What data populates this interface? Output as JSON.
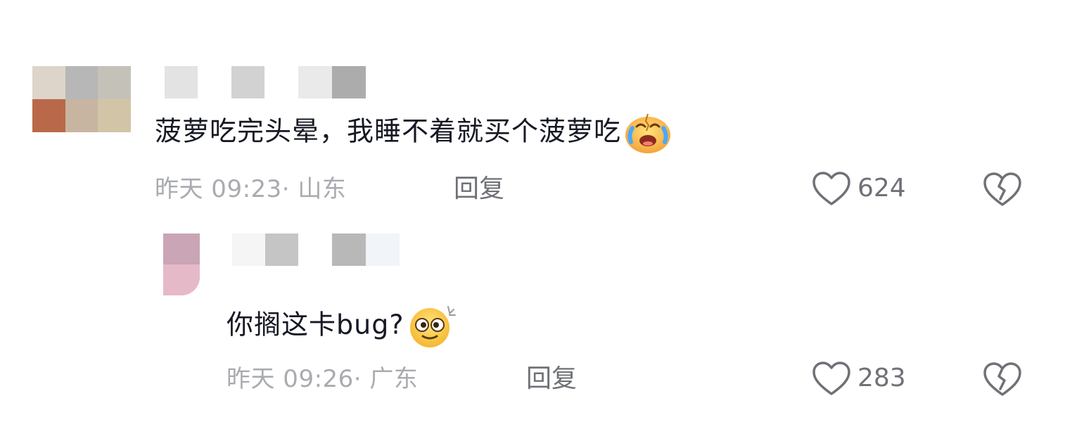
{
  "comments": [
    {
      "text": "菠萝吃完头晕，我睡不着就买个菠萝吃",
      "emoji": "crying-face-emoji",
      "meta": "昨天 09:23· 山东",
      "reply_label": "回复",
      "like_count": "624",
      "avatar_colors": [
        "#ddd4ca",
        "#b7b7b7",
        "#c4c1b8",
        "#b9694a",
        "#c7b5a1",
        "#d2c4a7"
      ],
      "name_colors_a": [
        "#e3e3e3",
        "#ffffff",
        "#d2d2d2",
        "#e3e3e3",
        "#ffffff",
        "#d2d2d2"
      ],
      "name_colors_b": [
        "#eaeaea",
        "#acacac"
      ]
    }
  ],
  "replies": [
    {
      "text": "你搁这卡bug?",
      "emoji": "dizzy-eyes-emoji",
      "meta": "昨天 09:26· 广东",
      "reply_label": "回复",
      "like_count": "283",
      "avatar_colors": [
        "#c9a5b5",
        "#e5b9c8"
      ],
      "name_colors_a": [
        "#f5f5f5",
        "#c5c5c5"
      ],
      "name_colors_b": [
        "#b8b8b8",
        "#f1f4f8"
      ]
    }
  ],
  "colors": {
    "text": "#161823",
    "meta": "#a9abb0",
    "action": "#6f7177"
  }
}
